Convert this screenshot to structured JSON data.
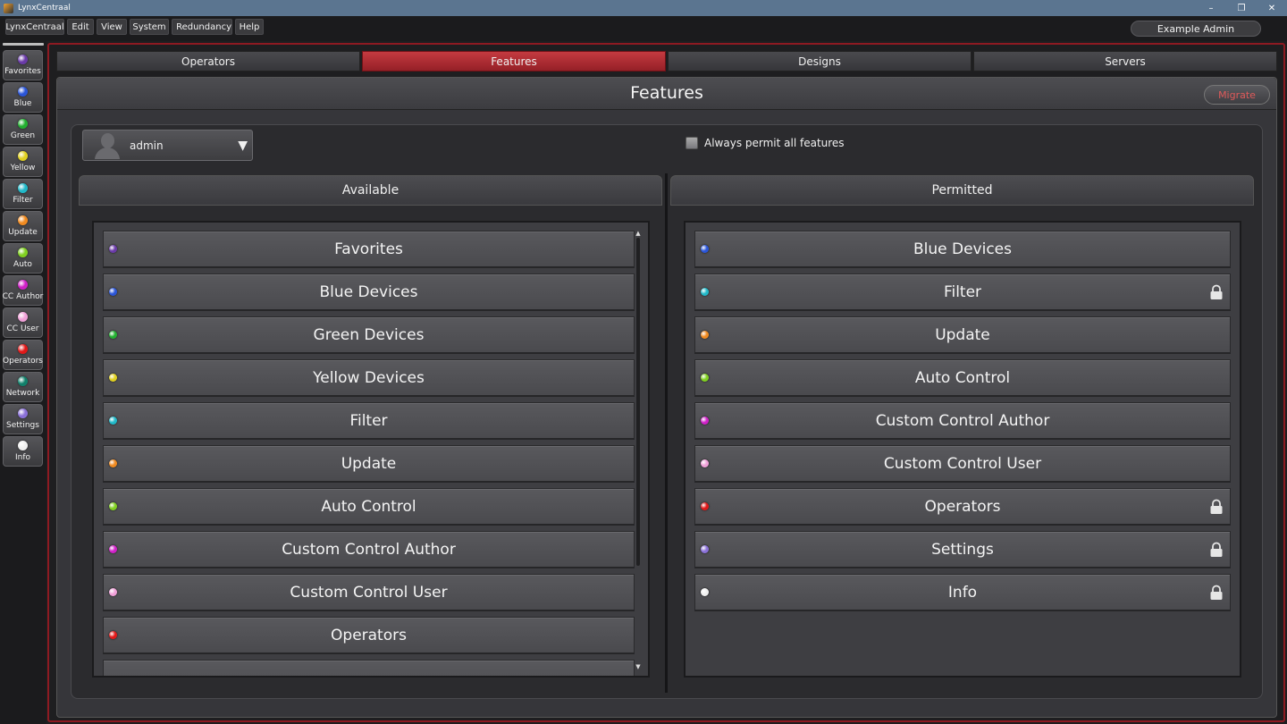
{
  "window": {
    "title": "LynxCentraal",
    "controls": [
      "–",
      "❐",
      "✕"
    ]
  },
  "menu": {
    "items": [
      {
        "label": "LynxCentraal",
        "icon": ""
      },
      {
        "label": "Edit",
        "icon": ""
      },
      {
        "label": "View",
        "icon": ""
      },
      {
        "label": "System",
        "icon": ""
      },
      {
        "label": "Redundancy",
        "icon": "red-dot"
      },
      {
        "label": "Help",
        "icon": ""
      }
    ],
    "user": "Example Admin"
  },
  "sidebar": {
    "items": [
      {
        "label": "Favorites",
        "color": "#6a3aa8"
      },
      {
        "label": "Blue",
        "color": "#2a55d8"
      },
      {
        "label": "Green",
        "color": "#22b030"
      },
      {
        "label": "Yellow",
        "color": "#e0d020"
      },
      {
        "label": "Filter",
        "color": "#20b8c8"
      },
      {
        "label": "Update",
        "color": "#f08a20"
      },
      {
        "label": "Auto",
        "color": "#80d020"
      },
      {
        "label": "CC Author",
        "color": "#d020c8"
      },
      {
        "label": "CC User",
        "color": "#f0a0d8"
      },
      {
        "label": "Operators",
        "color": "#e01818"
      },
      {
        "label": "Network",
        "color": "#10806a"
      },
      {
        "label": "Settings",
        "color": "#8a70d8"
      },
      {
        "label": "Info",
        "color": "#f0f0f0"
      }
    ]
  },
  "tabs": [
    {
      "label": "Operators",
      "active": false
    },
    {
      "label": "Features",
      "active": true
    },
    {
      "label": "Designs",
      "active": false
    },
    {
      "label": "Servers",
      "active": false
    }
  ],
  "features": {
    "title": "Features",
    "migrate_label": "Migrate",
    "user_select": "admin",
    "permit_all_label": "Always permit all features",
    "available_header": "Available",
    "permitted_header": "Permitted",
    "available": [
      {
        "label": "Favorites",
        "color": "#6a3aa8"
      },
      {
        "label": "Blue Devices",
        "color": "#2a55d8"
      },
      {
        "label": "Green Devices",
        "color": "#22b030"
      },
      {
        "label": "Yellow Devices",
        "color": "#e0d020"
      },
      {
        "label": "Filter",
        "color": "#20b8c8"
      },
      {
        "label": "Update",
        "color": "#f08a20"
      },
      {
        "label": "Auto Control",
        "color": "#80d020"
      },
      {
        "label": "Custom Control Author",
        "color": "#d020c8"
      },
      {
        "label": "Custom Control User",
        "color": "#f0a0d8"
      },
      {
        "label": "Operators",
        "color": "#e01818"
      },
      {
        "label": "",
        "color": ""
      }
    ],
    "permitted": [
      {
        "label": "Blue Devices",
        "color": "#2a55d8",
        "locked": false
      },
      {
        "label": "Filter",
        "color": "#20b8c8",
        "locked": true
      },
      {
        "label": "Update",
        "color": "#f08a20",
        "locked": false
      },
      {
        "label": "Auto Control",
        "color": "#80d020",
        "locked": false
      },
      {
        "label": "Custom Control Author",
        "color": "#d020c8",
        "locked": false
      },
      {
        "label": "Custom Control User",
        "color": "#f0a0d8",
        "locked": false
      },
      {
        "label": "Operators",
        "color": "#e01818",
        "locked": true
      },
      {
        "label": "Settings",
        "color": "#8a70d8",
        "locked": true
      },
      {
        "label": "Info",
        "color": "#f0f0f0",
        "locked": true
      }
    ]
  }
}
